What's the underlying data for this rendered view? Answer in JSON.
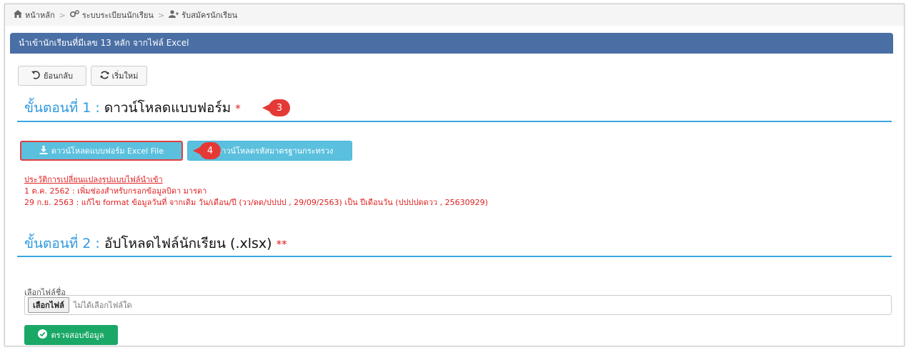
{
  "breadcrumb": {
    "home_icon": "home-icon",
    "home": "หน้าหลัก",
    "registry_icon": "cogs-icon",
    "registry": "ระบบระเบียนนักเรียน",
    "enroll_icon": "user-plus-icon",
    "enroll": "รับสมัครนักเรียน",
    "separator": ">"
  },
  "panel": {
    "title": "นำเข้านักเรียนที่มีเลข 13 หลัก จากไฟล์ Excel"
  },
  "toolbar": {
    "back_icon": "undo-icon",
    "back_label": "ย้อนกลับ",
    "restart_icon": "refresh-icon",
    "restart_label": "เริ่มใหม่"
  },
  "step1": {
    "label": "ขั้นตอนที่ 1 :",
    "title": "ดาวน์โหลดแบบฟอร์ม",
    "required_mark": "*",
    "download_icon": "download-icon",
    "download_excel_label": "ดาวน์โหลดแบบฟอร์ม Excel File",
    "download_codes_label": "ดาวน์โหลดรหัสมาตรฐานกระทรวง",
    "history_link": "ประวัติการเปลี่ยนแปลงรูปแบบไฟล์นำเข้า",
    "notes": [
      "1 ต.ค. 2562 : เพิ่มช่องสำหรับกรอกข้อมูลบิดา มารดา",
      "29 ก.ย. 2563 : แก้ไข format ข้อมูลวันที่ จากเดิม วัน/เดือน/ปี (วว/ดด/ปปปป , 29/09/2563) เป็น ปีเดือนวัน (ปปปปดดวว , 25630929)"
    ]
  },
  "step2": {
    "label": "ขั้นตอนที่ 2 :",
    "title": "อัปโหลดไฟล์นักเรียน (.xlsx)",
    "required_mark": "**",
    "file_label": "เลือกไฟล์ชื่อ",
    "file_button": "เลือกไฟล์",
    "file_status": "ไม่ได้เลือกไฟล์ใด",
    "check_icon": "check-circle-icon",
    "check_button": "ตรวจสอบข้อมูล"
  },
  "callouts": {
    "first": "3",
    "second": "4"
  },
  "colors": {
    "panel_header": "#4a6fa5",
    "step_label": "#2e9ae0",
    "required": "#e02020",
    "info_button": "#5bc0de",
    "success_button": "#1aa866",
    "callout": "#e53935"
  }
}
